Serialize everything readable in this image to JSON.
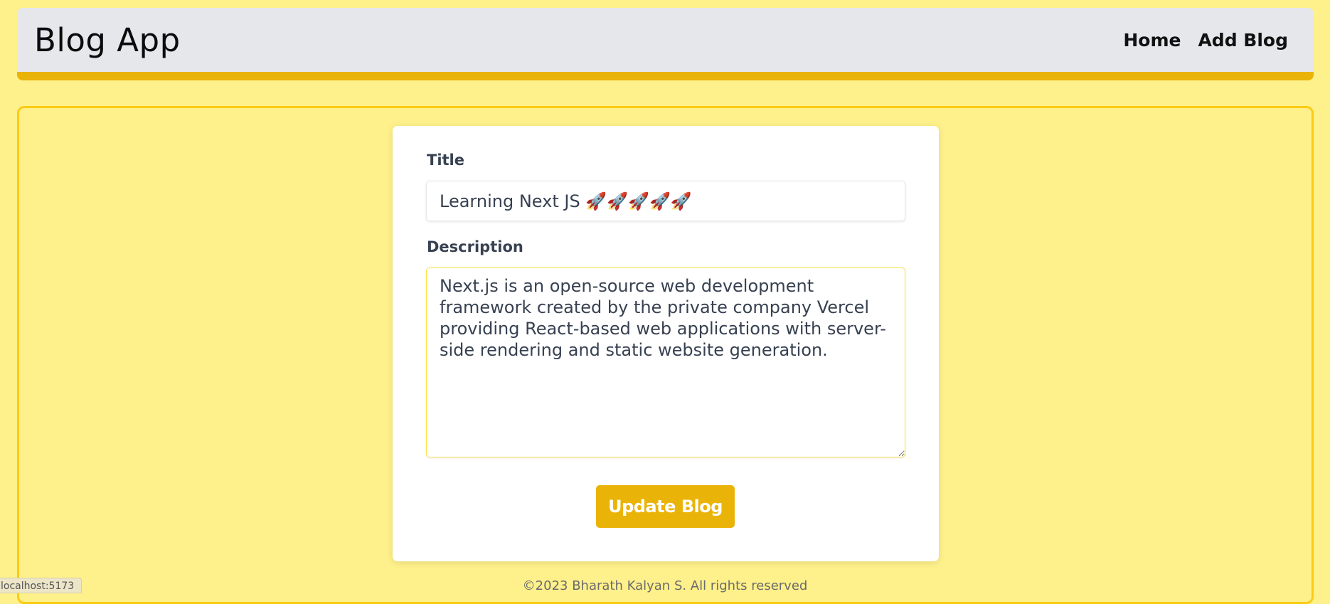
{
  "navbar": {
    "brand": "Blog App",
    "links": [
      {
        "label": "Home"
      },
      {
        "label": "Add Blog"
      }
    ]
  },
  "form": {
    "title_label": "Title",
    "title_value": "Learning Next JS 🚀🚀🚀🚀🚀",
    "description_label": "Description",
    "description_value": "Next.js is an open-source web development framework created by the private company Vercel providing React-based web applications with server-side rendering and static website generation.",
    "submit_label": "Update Blog"
  },
  "footer": {
    "text": "©2023 Bharath Kalyan S. All rights reserved"
  },
  "statusbar": {
    "url": "localhost:5173"
  },
  "colors": {
    "page_bg": "#fef08a",
    "navbar_bg": "#e5e7eb",
    "accent": "#eab308",
    "card_bg": "#ffffff"
  }
}
